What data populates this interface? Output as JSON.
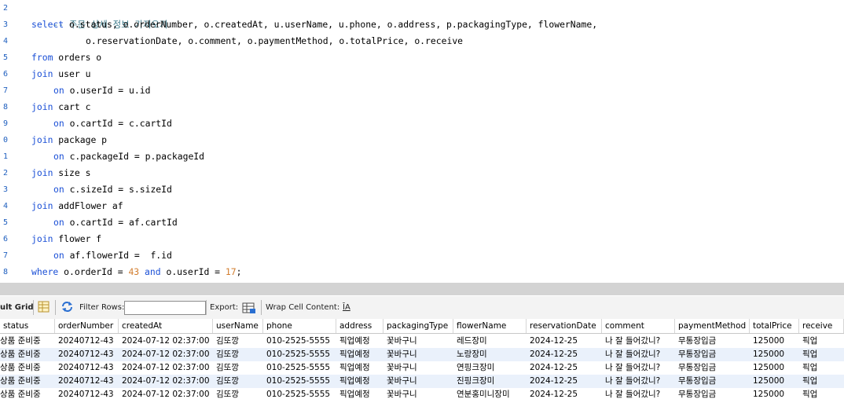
{
  "editor": {
    "line_numbers": [
      "2",
      "3",
      "4",
      "5",
      "6",
      "7",
      "8",
      "9",
      "0",
      "1",
      "2",
      "3",
      "4",
      "5",
      "6",
      "7",
      "8"
    ],
    "comment": "-- 주문 상세 정보 가져오기",
    "select_kw": "select",
    "select_fields_1": " o.status, o.orderNumber, o.createdAt, u.userName, u.phone, o.address, p.packagingType, flowerName,",
    "select_fields_2": "o.reservationDate, o.comment, o.paymentMethod, o.totalPrice, o.receive",
    "from_kw": "from",
    "from_rest": " orders o",
    "join_kw": "join",
    "on_kw": "on",
    "join_user": " user u",
    "on_user": " o.userId = u.id",
    "join_cart": " cart c",
    "on_cart": " o.cartId = c.cartId",
    "join_package": " package p",
    "on_package": " c.packageId = p.packageId",
    "join_size": " size s",
    "on_size": " c.sizeId = s.sizeId",
    "join_addflower": " addFlower af",
    "on_addflower": " o.cartId = af.cartId",
    "join_flower": " flower f",
    "on_flower": " af.flowerId =  f.id",
    "where_kw": "where",
    "where_1": " o.orderId = ",
    "where_num1": "43",
    "and_kw": " and",
    "where_2": " o.userId = ",
    "where_num2": "17",
    "where_end": ";"
  },
  "toolbar": {
    "result_grid_label": "ult Grid",
    "filter_rows_label": "Filter Rows:",
    "filter_value": "",
    "export_label": "Export:",
    "wrap_label": "Wrap Cell Content:",
    "wrap_icon_text": "ĪA"
  },
  "grid": {
    "columns": [
      "status",
      "orderNumber",
      "createdAt",
      "userName",
      "phone",
      "address",
      "packagingType",
      "flowerName",
      "reservationDate",
      "comment",
      "paymentMethod",
      "totalPrice",
      "receive"
    ],
    "rows": [
      [
        "상품 준비중",
        "20240712-43",
        "2024-07-12 02:37:00",
        "김또깡",
        "010-2525-5555",
        "픽업예정",
        "꽃바구니",
        "레드장미",
        "2024-12-25",
        "나 잘 들어갔니?",
        "무통장입금",
        "125000",
        "픽업"
      ],
      [
        "상품 준비중",
        "20240712-43",
        "2024-07-12 02:37:00",
        "김또깡",
        "010-2525-5555",
        "픽업예정",
        "꽃바구니",
        "노랑장미",
        "2024-12-25",
        "나 잘 들어갔니?",
        "무통장입금",
        "125000",
        "픽업"
      ],
      [
        "상품 준비중",
        "20240712-43",
        "2024-07-12 02:37:00",
        "김또깡",
        "010-2525-5555",
        "픽업예정",
        "꽃바구니",
        "연핑크장미",
        "2024-12-25",
        "나 잘 들어갔니?",
        "무통장입금",
        "125000",
        "픽업"
      ],
      [
        "상품 준비중",
        "20240712-43",
        "2024-07-12 02:37:00",
        "김또깡",
        "010-2525-5555",
        "픽업예정",
        "꽃바구니",
        "진핑크장미",
        "2024-12-25",
        "나 잘 들어갔니?",
        "무통장입금",
        "125000",
        "픽업"
      ],
      [
        "상품 준비중",
        "20240712-43",
        "2024-07-12 02:37:00",
        "김또깡",
        "010-2525-5555",
        "픽업예정",
        "꽃바구니",
        "연분홍미니장미",
        "2024-12-25",
        "나 잘 들어갔니?",
        "무통장입금",
        "125000",
        "픽업"
      ]
    ]
  },
  "colors": {
    "keyword": "#1a4fd6",
    "comment": "#3c7a8a",
    "number": "#d27d2e",
    "alt_row": "#eaf1fb",
    "splitter": "#d3d3d3"
  }
}
